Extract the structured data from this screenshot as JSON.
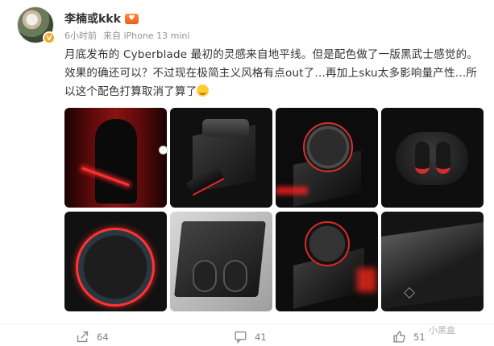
{
  "user": {
    "name": "李楠或kkk",
    "verified_badge": "V",
    "vip_icon": "heart-eyes-icon"
  },
  "meta": {
    "time": "6小时前",
    "source": "来自 iPhone 13 mini"
  },
  "post": {
    "text": "月底发布的 Cyberblade 最初的灵感来自地平线。但是配色做了一版黑武士感觉的。效果的确还可以？不过现在极简主义风格有点out了…再加上sku太多影响量产性…所以这个配色打算取消了算了"
  },
  "images": [
    {
      "name": "image-darth-vader"
    },
    {
      "name": "image-earbuds-box-1"
    },
    {
      "name": "image-puck-stand"
    },
    {
      "name": "image-earbuds-case"
    },
    {
      "name": "image-red-ring"
    },
    {
      "name": "image-earbuds-tray"
    },
    {
      "name": "image-knob-stand"
    },
    {
      "name": "image-slab-closeup"
    }
  ],
  "actions": {
    "share_count": "64",
    "comment_count": "41",
    "like_count": "51"
  },
  "watermark": "小黑盒",
  "colors": {
    "accent_red": "#e2262b",
    "vip_orange": "#f25a1a",
    "meta_gray": "#939393"
  }
}
